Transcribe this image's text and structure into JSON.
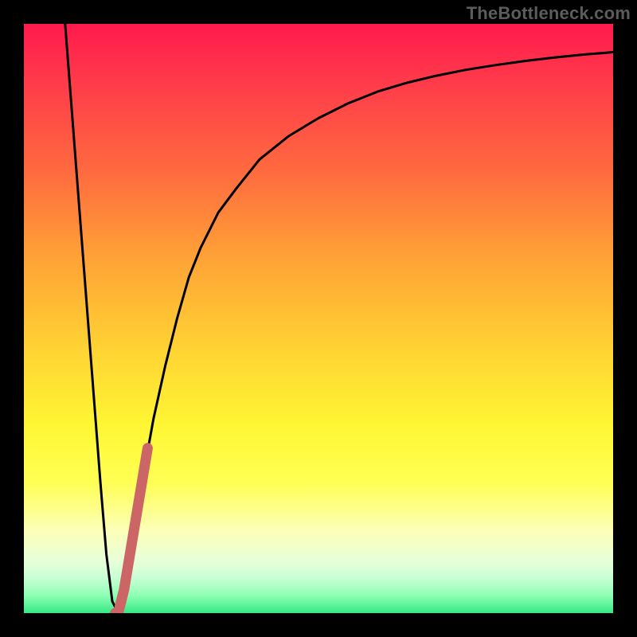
{
  "watermark": "TheBottleneck.com",
  "colors": {
    "background": "#000000",
    "curve": "#000000",
    "highlight": "#cc6666",
    "gradient_top": "#ff1a4d",
    "gradient_bottom": "#36e985"
  },
  "chart_data": {
    "type": "line",
    "title": "",
    "xlabel": "",
    "ylabel": "",
    "xlim": [
      0,
      100
    ],
    "ylim": [
      0,
      100
    ],
    "grid": false,
    "legend": false,
    "series": [
      {
        "name": "bottleneck-curve",
        "x": [
          7,
          8,
          9,
          10,
          11,
          12,
          13,
          14,
          15,
          16,
          17,
          18,
          20,
          22,
          24,
          26,
          28,
          30,
          33,
          36,
          40,
          45,
          50,
          55,
          60,
          65,
          70,
          75,
          80,
          85,
          90,
          95,
          100
        ],
        "y": [
          100,
          87,
          74,
          61,
          48,
          35,
          22,
          10,
          2,
          0,
          4,
          10,
          22,
          33,
          42,
          50,
          57,
          62,
          68,
          72,
          77,
          81,
          84,
          86.5,
          88.5,
          90,
          91.2,
          92.2,
          93,
          93.7,
          94.3,
          94.8,
          95.2
        ]
      },
      {
        "name": "highlight-segment",
        "x": [
          15.5,
          16,
          17,
          18,
          19,
          20,
          21
        ],
        "y": [
          0,
          0,
          4,
          10,
          16,
          22,
          28
        ]
      }
    ]
  }
}
